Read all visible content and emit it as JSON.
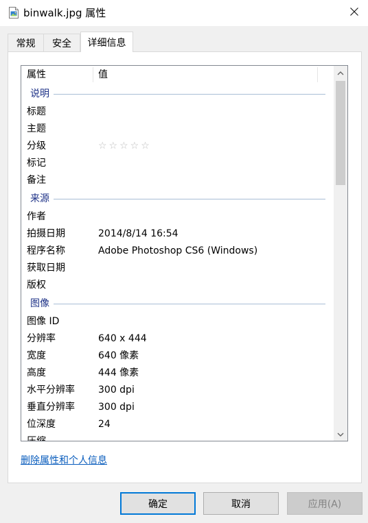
{
  "window": {
    "title": "binwalk.jpg 属性",
    "icon": "jpg-file-icon",
    "close_icon": "close-icon"
  },
  "tabs": [
    {
      "label": "常规",
      "active": false
    },
    {
      "label": "安全",
      "active": false
    },
    {
      "label": "详细信息",
      "active": true
    }
  ],
  "details": {
    "columns": {
      "property": "属性",
      "value": "值"
    },
    "groups": [
      {
        "name": "说明",
        "rows": [
          {
            "name": "标题",
            "value": ""
          },
          {
            "name": "主题",
            "value": ""
          },
          {
            "name": "分级",
            "value": "",
            "rating": 0
          },
          {
            "name": "标记",
            "value": ""
          },
          {
            "name": "备注",
            "value": ""
          }
        ]
      },
      {
        "name": "来源",
        "rows": [
          {
            "name": "作者",
            "value": ""
          },
          {
            "name": "拍摄日期",
            "value": "2014/8/14 16:54"
          },
          {
            "name": "程序名称",
            "value": "Adobe Photoshop CS6 (Windows)"
          },
          {
            "name": "获取日期",
            "value": ""
          },
          {
            "name": "版权",
            "value": ""
          }
        ]
      },
      {
        "name": "图像",
        "rows": [
          {
            "name": "图像 ID",
            "value": ""
          },
          {
            "name": "分辨率",
            "value": "640 x 444"
          },
          {
            "name": "宽度",
            "value": "640 像素"
          },
          {
            "name": "高度",
            "value": "444 像素"
          },
          {
            "name": "水平分辨率",
            "value": "300 dpi"
          },
          {
            "name": "垂直分辨率",
            "value": "300 dpi"
          },
          {
            "name": "位深度",
            "value": "24"
          },
          {
            "name": "压缩",
            "value": ""
          }
        ]
      }
    ],
    "rating_stars": "☆☆☆☆☆"
  },
  "remove_link": "删除属性和个人信息",
  "buttons": {
    "ok": "确定",
    "cancel": "取消",
    "apply": "应用(A)"
  },
  "colors": {
    "accent": "#0078d7",
    "group_text": "#1e3287",
    "link": "#0a5dbd"
  }
}
